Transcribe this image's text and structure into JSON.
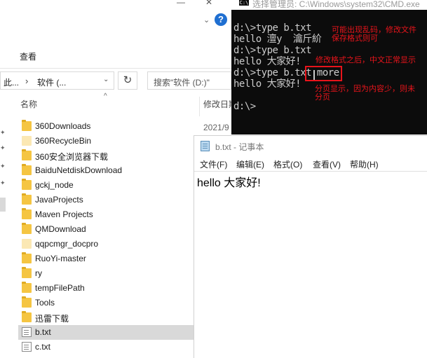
{
  "explorer": {
    "ribbon_tab": "查看",
    "address": {
      "prefix": "此...",
      "separator": "›",
      "path": "软件 (...",
      "dropdown": "⌄"
    },
    "refresh_glyph": "↻",
    "search_placeholder": "搜索\"软件 (D:)\"",
    "columns": {
      "name": "名称",
      "date": "修改日期",
      "sort_glyph": "^"
    },
    "date_fragment": "2021/9",
    "files": [
      {
        "name": "360Downloads",
        "kind": "folder"
      },
      {
        "name": "360RecycleBin",
        "kind": "folder-pale"
      },
      {
        "name": "360安全浏览器下载",
        "kind": "folder"
      },
      {
        "name": "BaiduNetdiskDownload",
        "kind": "folder"
      },
      {
        "name": "gckj_node",
        "kind": "folder"
      },
      {
        "name": "JavaProjects",
        "kind": "folder"
      },
      {
        "name": "Maven Projects",
        "kind": "folder"
      },
      {
        "name": "QMDownload",
        "kind": "folder"
      },
      {
        "name": "qqpcmgr_docpro",
        "kind": "folder-pale"
      },
      {
        "name": "RuoYi-master",
        "kind": "folder"
      },
      {
        "name": "ry",
        "kind": "folder"
      },
      {
        "name": "tempFilePath",
        "kind": "folder"
      },
      {
        "name": "Tools",
        "kind": "folder"
      },
      {
        "name": "迅雷下载",
        "kind": "folder"
      },
      {
        "name": "b.txt",
        "kind": "doc",
        "selected": true
      },
      {
        "name": "c.txt",
        "kind": "doc"
      }
    ],
    "help_glyph": "?"
  },
  "cmd": {
    "icon_text": "C:\\",
    "title": "选择管理员: C:\\Windows\\system32\\CMD.exe",
    "lines": [
      "d:\\>type b.txt",
      "hello 澶у  瀹斤紒",
      "d:\\>type b.txt",
      "hello 大家好!",
      "d:\\>type b.txt more",
      "hello 大家好!",
      "",
      "d:\\>"
    ],
    "annotations": {
      "a1_line1": "可能出现乱码，修改文件",
      "a1_line2": "保存格式则可",
      "a2": "修改格式之后，中文正常显示",
      "a3_line1": "分页显示，因为内容少，则未",
      "a3_line2": "分页"
    },
    "highlight_color": "#e8141b"
  },
  "notepad": {
    "title": "b.txt - 记事本",
    "menu": [
      "文件(F)",
      "编辑(E)",
      "格式(O)",
      "查看(V)",
      "帮助(H)"
    ],
    "content": "hello 大家好!"
  }
}
